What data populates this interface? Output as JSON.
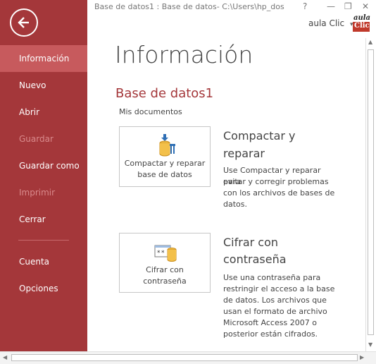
{
  "window": {
    "title": "Base de datos1 : Base de datos- C:\\Users\\hp_dos\\...",
    "help_glyph": "?",
    "minimize_glyph": "—",
    "restore_glyph": "❐",
    "close_glyph": "✕"
  },
  "user": {
    "name": "aula Clic",
    "dropdown_glyph": "▾"
  },
  "logo": {
    "line1": "aula",
    "line2": "Clic"
  },
  "sidebar": {
    "items": [
      {
        "label": "Información",
        "state": "active"
      },
      {
        "label": "Nuevo",
        "state": "normal"
      },
      {
        "label": "Abrir",
        "state": "normal"
      },
      {
        "label": "Guardar",
        "state": "disabled"
      },
      {
        "label": "Guardar como",
        "state": "normal"
      },
      {
        "label": "Imprimir",
        "state": "disabled"
      },
      {
        "label": "Cerrar",
        "state": "normal"
      },
      {
        "label": "Cuenta",
        "state": "normal"
      },
      {
        "label": "Opciones",
        "state": "normal"
      }
    ]
  },
  "main": {
    "title": "Información",
    "db_name": "Base de datos1",
    "db_location": "Mis documentos",
    "sections": [
      {
        "button_label_line1": "Compactar y reparar",
        "button_label_line2": "base de datos",
        "icon": "compact-repair-icon",
        "title_line1": "Compactar y",
        "title_line2": "reparar",
        "desc_lines": [
          "Use Compactar y reparar para",
          "evitar y corregir problemas",
          "con los archivos de bases de",
          "datos."
        ]
      },
      {
        "button_label_line1": "Cifrar con",
        "button_label_line2": "contraseña",
        "icon": "encrypt-password-icon",
        "title_line1": "Cifrar con",
        "title_line2": "contraseña",
        "desc_lines": [
          "Use una contraseña para",
          "restringir el acceso a la base",
          "de datos. Los archivos que",
          "usan el formato de archivo",
          "Microsoft Access 2007 o",
          "posterior están cifrados."
        ]
      }
    ]
  },
  "colors": {
    "sidebar": "#a4373a",
    "sidebar_active": "#c75a5d",
    "accent_text": "#a4373a"
  }
}
